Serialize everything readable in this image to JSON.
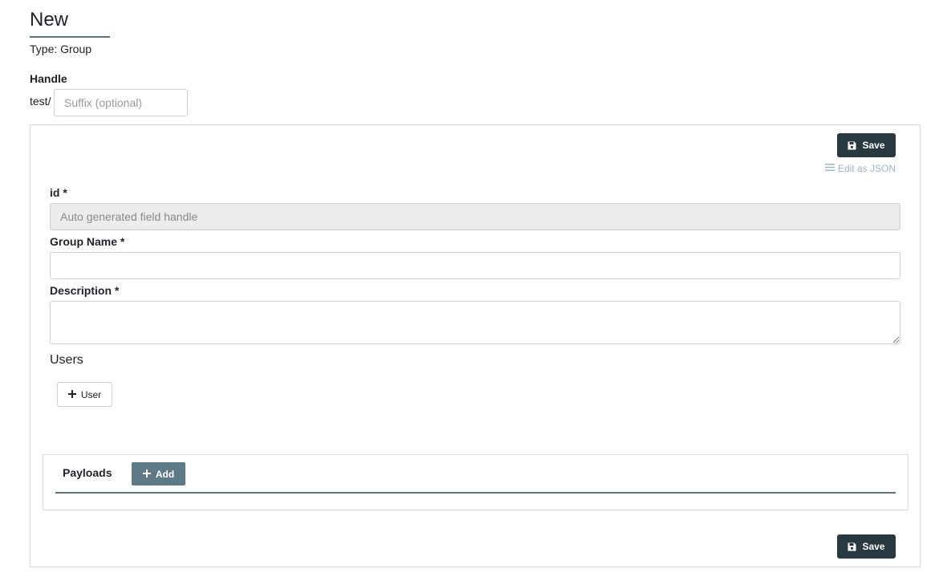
{
  "header": {
    "title": "New",
    "type_line": "Type: Group"
  },
  "handle": {
    "label": "Handle",
    "prefix": "test/",
    "placeholder": "Suffix (optional)"
  },
  "form": {
    "save_label": "Save",
    "edit_json_label": "Edit as JSON",
    "fields": {
      "id": {
        "label": "id *",
        "placeholder": "Auto generated field handle"
      },
      "group_name": {
        "label": "Group Name *",
        "value": ""
      },
      "description": {
        "label": "Description *",
        "value": ""
      }
    },
    "users": {
      "heading": "Users",
      "add_user_label": "User"
    },
    "payloads": {
      "label": "Payloads",
      "add_label": "Add"
    }
  },
  "colors": {
    "primary_button": "#28393f",
    "secondary_button": "#5f7a87",
    "accent_rule": "#5d7480",
    "link_muted": "#9fb3c0"
  },
  "icons": {
    "save": "floppy-disk-icon",
    "edit_json": "list-lines-icon",
    "add": "plus-icon"
  }
}
